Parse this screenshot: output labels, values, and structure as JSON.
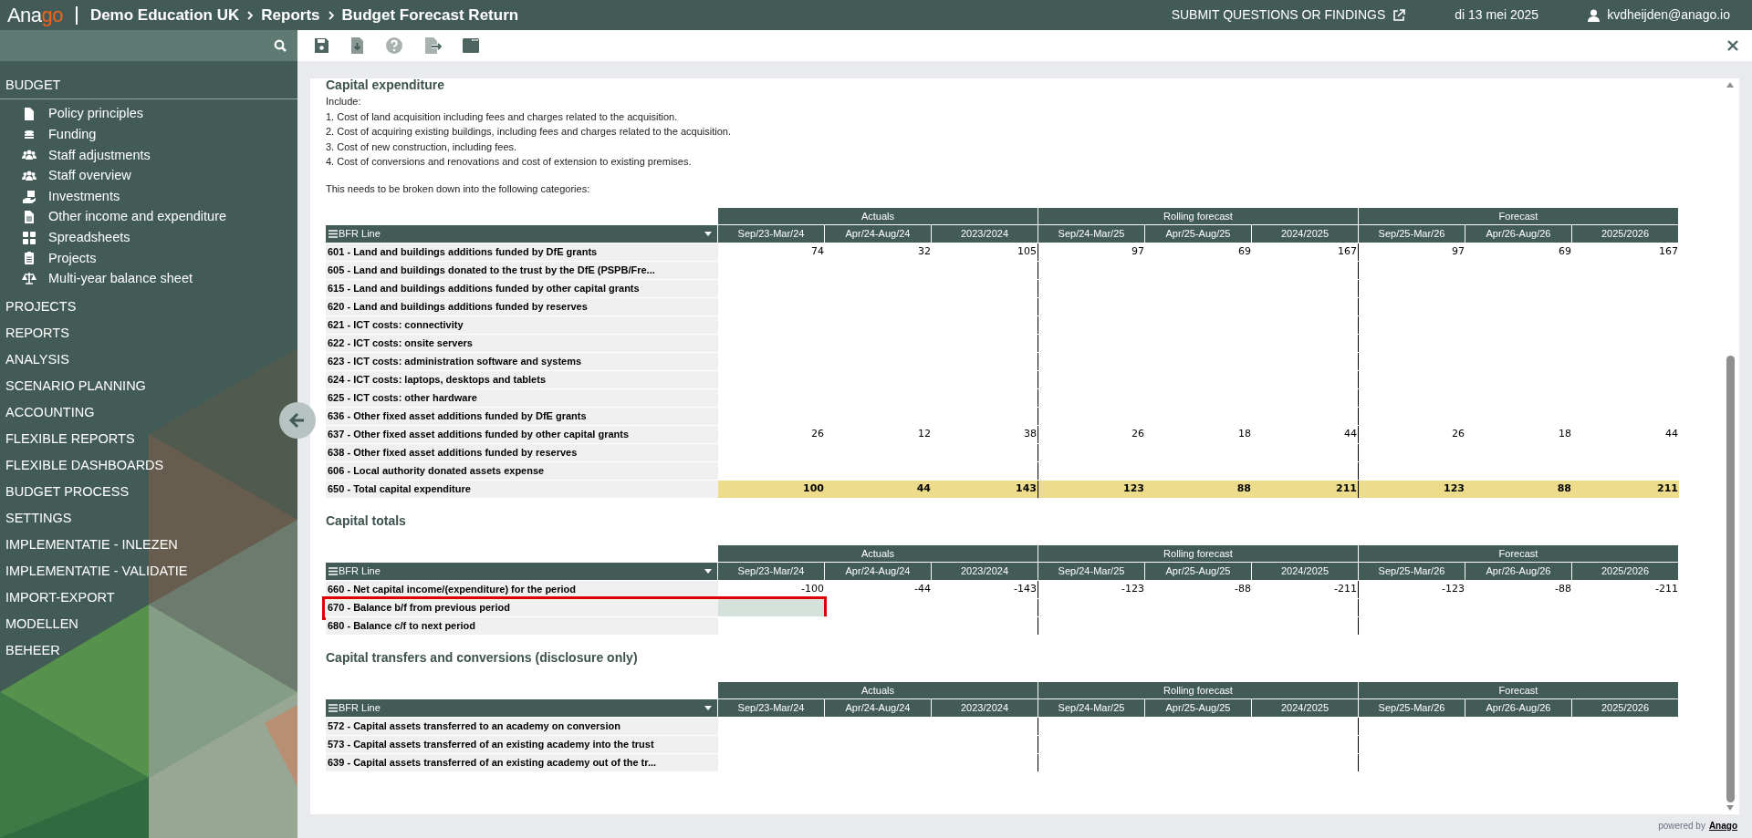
{
  "header": {
    "logo": {
      "primary": "Ana",
      "accent": "go"
    },
    "breadcrumb": [
      "Demo Education UK",
      "Reports",
      "Budget Forecast Return"
    ],
    "feedback_link": "SUBMIT QUESTIONS OR FINDINGS",
    "date": "di 13 mei 2025",
    "user": "kvdheijden@anago.io"
  },
  "sidebar": {
    "items": [
      {
        "label": "BUDGET",
        "expanded": true,
        "children": [
          {
            "label": "Policy principles"
          },
          {
            "label": "Funding"
          },
          {
            "label": "Staff adjustments"
          },
          {
            "label": "Staff overview"
          },
          {
            "label": "Investments"
          },
          {
            "label": "Other income and expenditure"
          },
          {
            "label": "Spreadsheets"
          },
          {
            "label": "Projects"
          },
          {
            "label": "Multi-year balance sheet"
          }
        ]
      },
      {
        "label": "PROJECTS",
        "expanded": false
      },
      {
        "label": "REPORTS",
        "expanded": false
      },
      {
        "label": "ANALYSIS",
        "expanded": false
      },
      {
        "label": "SCENARIO PLANNING",
        "expanded": false
      },
      {
        "label": "ACCOUNTING",
        "expanded": false
      },
      {
        "label": "FLEXIBLE REPORTS",
        "expanded": false
      },
      {
        "label": "FLEXIBLE DASHBOARDS",
        "expanded": false
      },
      {
        "label": "BUDGET PROCESS",
        "expanded": false
      },
      {
        "label": "SETTINGS",
        "expanded": false
      },
      {
        "label": "IMPLEMENTATIE - INLEZEN",
        "expanded": false
      },
      {
        "label": "IMPLEMENTATIE - VALIDATIE",
        "expanded": false
      },
      {
        "label": "IMPORT-EXPORT",
        "expanded": false
      },
      {
        "label": "MODELLEN",
        "expanded": false
      },
      {
        "label": "BEHEER",
        "expanded": false
      }
    ]
  },
  "sections": [
    {
      "title": "Capital expenditure",
      "description": [
        "Include:",
        "1. Cost of land acquisition including fees and charges related to the acquisition.",
        "2. Cost of acquiring existing buildings, including fees and charges related to the acquisition.",
        "3. Cost of new construction, including fees.",
        "4. Cost of conversions and renovations and cost of extension to existing premises."
      ],
      "note": "This needs to be broken down into the following categories:",
      "table": {
        "label_header": "BFR Line",
        "groups": [
          {
            "label": "Actuals",
            "columns": [
              "Sep/23-Mar/24",
              "Apr/24-Aug/24",
              "2023/2024"
            ]
          },
          {
            "label": "Rolling forecast",
            "columns": [
              "Sep/24-Mar/25",
              "Apr/25-Aug/25",
              "2024/2025"
            ]
          },
          {
            "label": "Forecast",
            "columns": [
              "Sep/25-Mar/26",
              "Apr/26-Aug/26",
              "2025/2026"
            ]
          }
        ],
        "rows": [
          {
            "label": "601 - Land and buildings additions funded by DfE grants",
            "kind": "line",
            "selected": false,
            "values": [
              "74",
              "32",
              "105",
              "97",
              "69",
              "167",
              "97",
              "69",
              "167"
            ]
          },
          {
            "label": "605 - Land and buildings donated to the trust by the DfE (PSPB/Fre...",
            "kind": "line",
            "selected": false
          },
          {
            "label": "615 - Land and buildings additions funded by other capital grants",
            "kind": "line",
            "selected": false
          },
          {
            "label": "620 - Land and buildings additions funded by reserves",
            "kind": "line",
            "selected": false
          },
          {
            "label": "621 - ICT costs: connectivity",
            "kind": "line",
            "selected": false
          },
          {
            "label": "622 - ICT costs: onsite servers",
            "kind": "line",
            "selected": false
          },
          {
            "label": "623 - ICT costs: administration software and systems",
            "kind": "line",
            "selected": false
          },
          {
            "label": "624 - ICT costs: laptops, desktops and tablets",
            "kind": "line",
            "selected": false
          },
          {
            "label": "625 - ICT costs: other hardware",
            "kind": "line",
            "selected": false
          },
          {
            "label": "636 - Other fixed asset additions funded by DfE grants",
            "kind": "line",
            "selected": false
          },
          {
            "label": "637 - Other fixed asset additions funded by other capital grants",
            "kind": "line",
            "selected": false,
            "values": [
              "26",
              "12",
              "38",
              "26",
              "18",
              "44",
              "26",
              "18",
              "44"
            ]
          },
          {
            "label": "638 - Other fixed asset additions funded by reserves",
            "kind": "line",
            "selected": false
          },
          {
            "label": "606 - Local authority donated assets expense",
            "kind": "line",
            "selected": false
          },
          {
            "label": "650 - Total capital expenditure",
            "kind": "total",
            "selected": false,
            "values": [
              "100",
              "44",
              "143",
              "123",
              "88",
              "211",
              "123",
              "88",
              "211"
            ]
          }
        ]
      }
    },
    {
      "title": "Capital totals",
      "table": {
        "label_header": "BFR Line",
        "groups": [
          {
            "label": "Actuals",
            "columns": [
              "Sep/23-Mar/24",
              "Apr/24-Aug/24",
              "2023/2024"
            ]
          },
          {
            "label": "Rolling forecast",
            "columns": [
              "Sep/24-Mar/25",
              "Apr/25-Aug/25",
              "2024/2025"
            ]
          },
          {
            "label": "Forecast",
            "columns": [
              "Sep/25-Mar/26",
              "Apr/26-Aug/26",
              "2025/2026"
            ]
          }
        ],
        "rows": [
          {
            "label": "660 - Net capital income/(expenditure) for the period",
            "kind": "line",
            "selected": false,
            "values": [
              "-100",
              "-44",
              "-143",
              "-123",
              "-88",
              "-211",
              "-123",
              "-88",
              "-211"
            ]
          },
          {
            "label": "670 - Balance b/f from previous period",
            "kind": "line",
            "selected": true
          },
          {
            "label": "680 - Balance c/f to next period",
            "kind": "line",
            "selected": false
          }
        ]
      }
    },
    {
      "title": "Capital transfers and conversions (disclosure only)",
      "table": {
        "label_header": "BFR Line",
        "groups": [
          {
            "label": "Actuals",
            "columns": [
              "Sep/23-Mar/24",
              "Apr/24-Aug/24",
              "2023/2024"
            ]
          },
          {
            "label": "Rolling forecast",
            "columns": [
              "Sep/24-Mar/25",
              "Apr/25-Aug/25",
              "2024/2025"
            ]
          },
          {
            "label": "Forecast",
            "columns": [
              "Sep/25-Mar/26",
              "Apr/26-Aug/26",
              "2025/2026"
            ]
          }
        ],
        "rows": [
          {
            "label": "572 - Capital assets transferred to an academy on conversion",
            "kind": "line",
            "selected": false
          },
          {
            "label": "573 - Capital assets transferred of an existing academy into the trust",
            "kind": "line",
            "selected": false
          },
          {
            "label": "639 - Capital assets transferred of an existing academy out of the tr...",
            "kind": "line",
            "selected": false
          }
        ]
      }
    }
  ],
  "footer": {
    "text": "powered by",
    "link": "Anago"
  }
}
